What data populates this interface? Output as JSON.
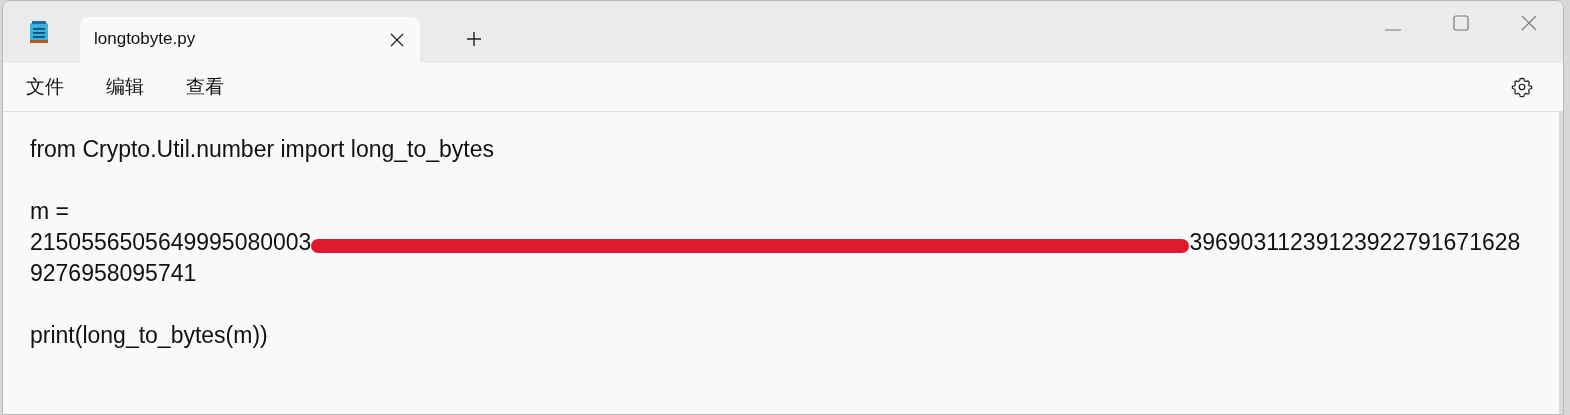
{
  "tabs": [
    {
      "label": "longtobyte.py",
      "selected": true
    }
  ],
  "menu": [
    {
      "label": "文件"
    },
    {
      "label": "编辑"
    },
    {
      "label": "查看"
    }
  ],
  "editor": {
    "lines": [
      {
        "kind": "text",
        "text": "from Crypto.Util.number import long_to_bytes"
      },
      {
        "kind": "blank"
      },
      {
        "kind": "text",
        "text": "m ="
      },
      {
        "kind": "redacted",
        "before": "2150556505649995080003",
        "after": "39690311239123922791671628"
      },
      {
        "kind": "text",
        "text": "9276958095741"
      },
      {
        "kind": "blank"
      },
      {
        "kind": "text",
        "text": "print(long_to_bytes(m))"
      }
    ]
  }
}
